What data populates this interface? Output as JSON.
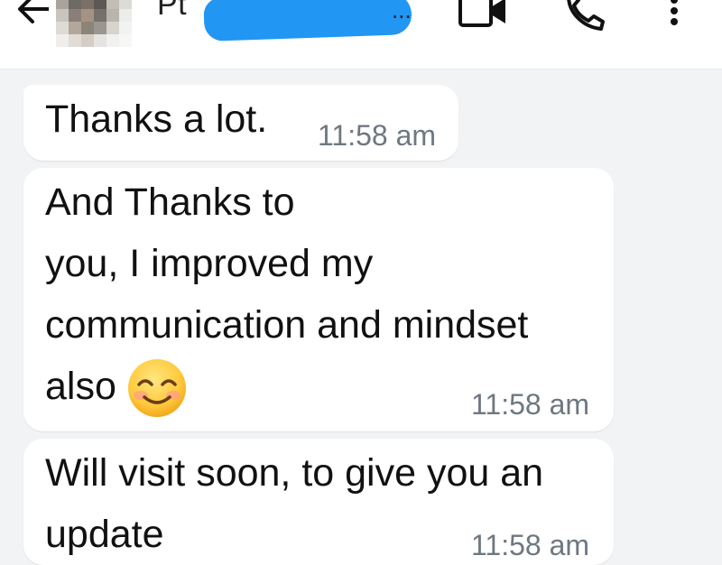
{
  "header": {
    "contact_name_visible": "Pt",
    "name_suffix": "...",
    "icons": [
      "back-arrow-icon",
      "video-call-icon",
      "phone-call-icon",
      "more-options-icon"
    ]
  },
  "messages": [
    {
      "text": "Thanks a lot.",
      "time": "11:58 am"
    },
    {
      "text": "And Thanks to\nyou, I improved my\ncommunication and mindset\nalso",
      "emoji": "smiling-face-icon",
      "time": "11:58 am"
    },
    {
      "text": "Will visit soon, to give you an\nupdate",
      "time": "11:58 am"
    }
  ],
  "colors": {
    "background": "#f2f3f5",
    "bubble": "#ffffff",
    "redaction": "#2196f3",
    "timestamp": "#6f7780"
  }
}
